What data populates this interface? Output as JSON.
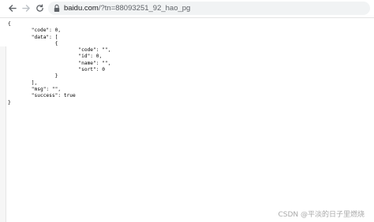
{
  "browser": {
    "url_domain": "baidu.com",
    "url_path": "/?tn=88093251_92_hao_pg"
  },
  "json_lines": [
    "{",
    "        \"code\": 0,",
    "        \"data\": [",
    "                {",
    "                        \"code\": \"\",",
    "                        \"id\": 0,",
    "                        \"name\": \"\",",
    "                        \"sort\": 0",
    "                }",
    "        ],",
    "        \"msg\": \"\",",
    "        \"success\": true",
    "}"
  ],
  "watermark": "CSDN @平淡的日子里燃烧",
  "colors": {
    "chrome_bg": "#ffffff",
    "address_bg": "#f1f3f4",
    "text": "#000000",
    "watermark": "#a9a9a9"
  }
}
